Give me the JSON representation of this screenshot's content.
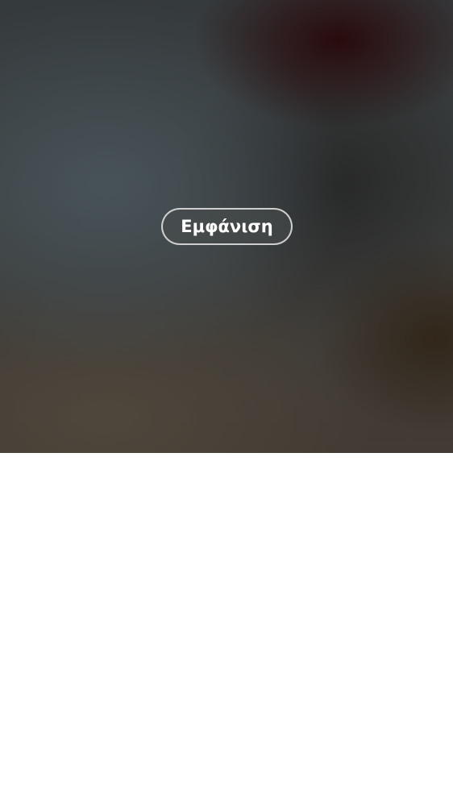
{
  "media": {
    "reveal_button_label": "Εμφάνιση"
  }
}
